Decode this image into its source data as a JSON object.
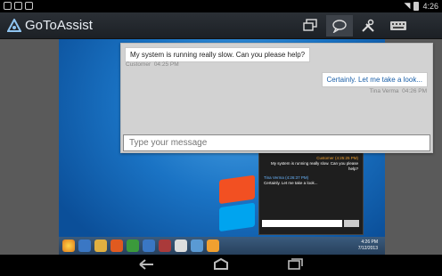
{
  "statusbar": {
    "time": "4:26"
  },
  "app": {
    "title": "GoToAssist"
  },
  "toolbar": {
    "items": [
      {
        "name": "screen-view-icon"
      },
      {
        "name": "chat-icon",
        "active": true
      },
      {
        "name": "tools-icon"
      },
      {
        "name": "keyboard-icon"
      }
    ]
  },
  "chat": {
    "messages": [
      {
        "text": "My system is running really slow. Can you please help?",
        "sender": "Customer",
        "time": "04:25 PM"
      },
      {
        "text": "Certainly. Let me take a look...",
        "sender": "Tina Verma",
        "time": "04:26 PM"
      }
    ],
    "input_placeholder": "Type your message"
  },
  "colors": {
    "agent_text": "#1a5fa8",
    "appbar_bg": "#23282d"
  }
}
